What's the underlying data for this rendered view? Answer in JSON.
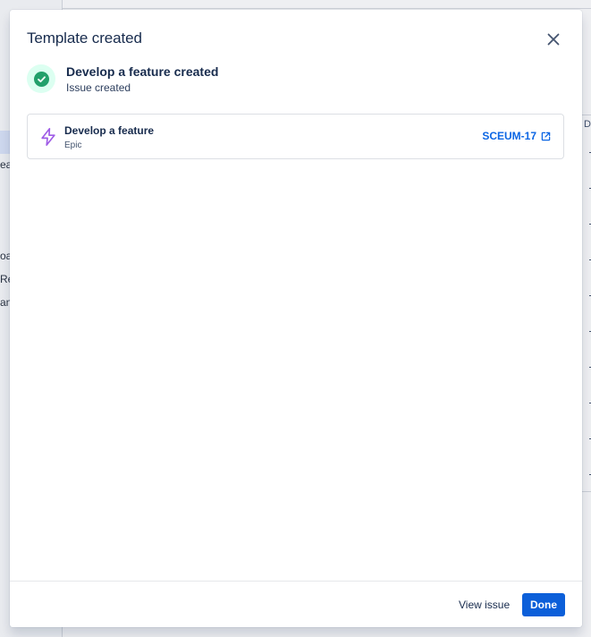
{
  "background": {
    "sidebar_fragments": [
      "ea",
      "oa",
      "Re",
      "an"
    ],
    "table_header_fragment": "D"
  },
  "modal": {
    "title": "Template created",
    "close_icon": "close-icon",
    "success": {
      "icon": "check-circle-icon",
      "title": "Develop a feature created",
      "subtitle": "Issue created"
    },
    "issue": {
      "icon": "lightning-epic-icon",
      "name": "Develop a feature",
      "type": "Epic",
      "key": "SCEUM-17",
      "link_icon": "external-link-icon"
    },
    "footer": {
      "secondary_label": "View issue",
      "primary_label": "Done"
    }
  },
  "colors": {
    "accent": "#0c5fd9",
    "link": "#0c66e4",
    "success": "#22a06b",
    "success_bg": "#dcfff1",
    "epic": "#9f5ce6",
    "text": "#172b4d"
  }
}
